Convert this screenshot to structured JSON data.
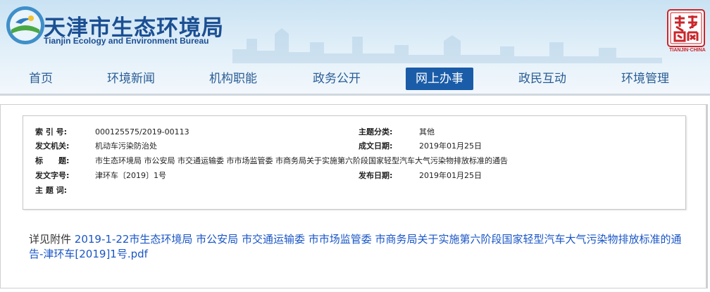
{
  "site": {
    "title": "天津市生态环境局",
    "subtitle": "Tianjin Ecology and Environment Bureau",
    "seal_text": "天津政务网",
    "seal_caption": "TIANJIN·CHINA"
  },
  "nav": {
    "items": [
      {
        "label": "首页",
        "active": false
      },
      {
        "label": "环境新闻",
        "active": false
      },
      {
        "label": "机构职能",
        "active": false
      },
      {
        "label": "政务公开",
        "active": false
      },
      {
        "label": "网上办事",
        "active": true
      },
      {
        "label": "政民互动",
        "active": false
      },
      {
        "label": "环境管理",
        "active": false
      }
    ]
  },
  "meta": {
    "index_label": "索 引 号:",
    "index_value": "000125575/2019-00113",
    "category_label": "主题分类:",
    "category_value": "其他",
    "issuer_label": "发文机关:",
    "issuer_value": "机动车污染防治处",
    "created_label": "成文日期:",
    "created_value": "2019年01月25日",
    "title_label": "标　　题:",
    "title_value": "市生态环境局 市公安局 市交通运输委 市市场监管委 市商务局关于实施第六阶段国家轻型汽车大气污染物排放标准的通告",
    "docno_label": "发文字号:",
    "docno_value": "津环车〔2019〕1号",
    "published_label": "发布日期:",
    "published_value": "2019年01月25日",
    "keywords_label": "主 题 词:",
    "keywords_value": ""
  },
  "attachment": {
    "prefix": "详见附件 ",
    "link_text": "2019-1-22市生态环境局 市公安局 市交通运输委 市市场监管委 市商务局关于实施第六阶段国家轻型汽车大气污染物排放标准的通告-津环车[2019]1号.pdf"
  },
  "colors": {
    "brand_blue": "#1b4f93",
    "nav_active_bg": "#1a5ca8",
    "link_blue": "#1a56c6",
    "seal_red": "#c9262b"
  }
}
